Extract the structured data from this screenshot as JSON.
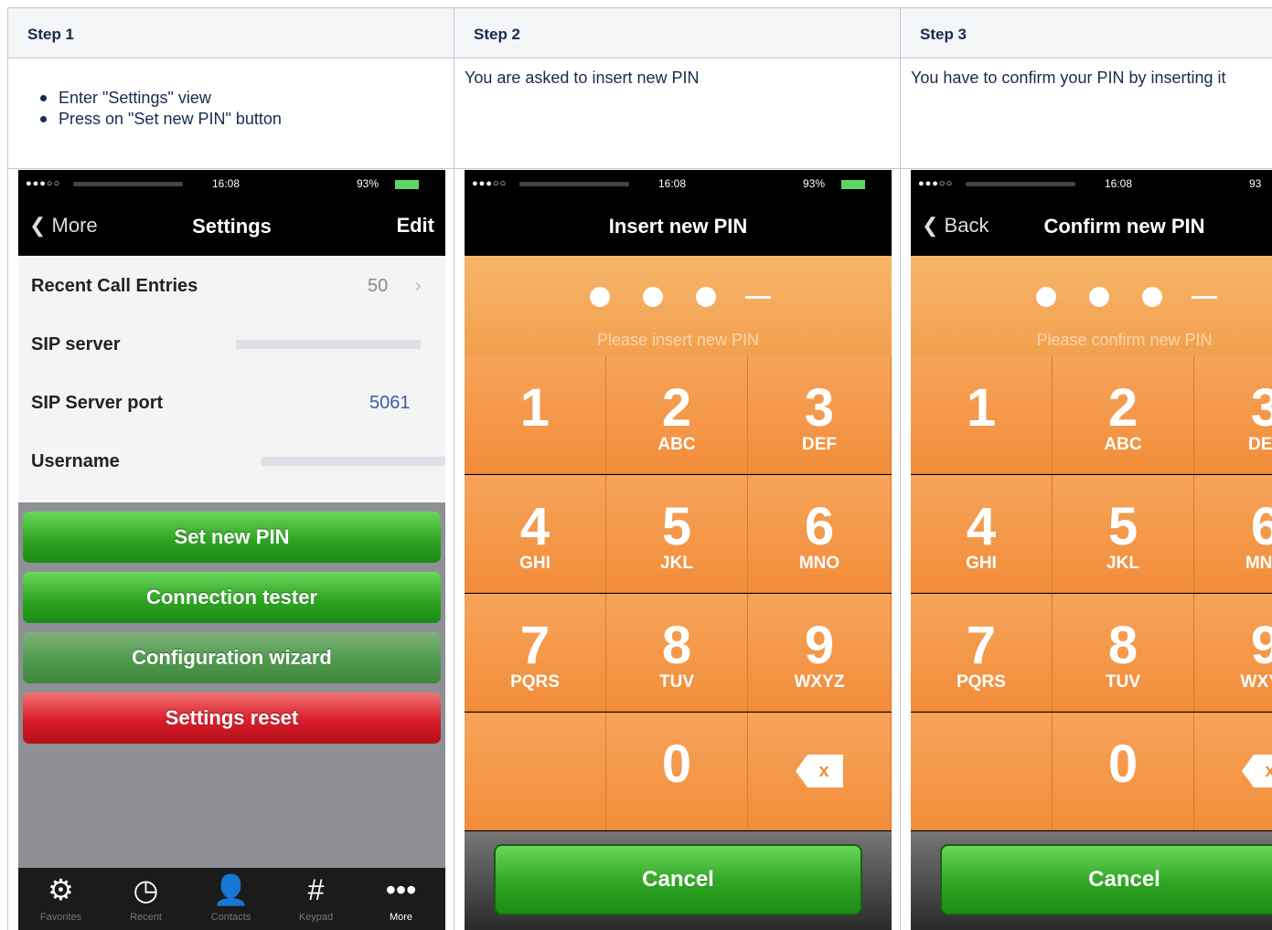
{
  "steps": [
    {
      "header": "Step 1",
      "bullets": [
        "Enter \"Settings\" view",
        "Press on \"Set new PIN\" button"
      ],
      "phone": {
        "status": {
          "time": "16:08",
          "battery": "93%"
        },
        "nav": {
          "back": "More",
          "title": "Settings",
          "action": "Edit"
        },
        "rows": [
          {
            "label": "Recent Call Entries",
            "value": "50"
          },
          {
            "label": "SIP server",
            "value": ""
          },
          {
            "label": "SIP Server port",
            "value": "5061"
          },
          {
            "label": "Username",
            "value": ""
          }
        ],
        "buttons": [
          "Set new PIN",
          "Connection tester",
          "Configuration wizard",
          "Settings reset"
        ],
        "tabs": [
          "Favorites",
          "Recent",
          "Contacts",
          "Keypad",
          "More"
        ]
      }
    },
    {
      "header": "Step 2",
      "description": "You are asked to insert new PIN",
      "phone": {
        "status": {
          "time": "16:08",
          "battery": "93%"
        },
        "nav": {
          "title": "Insert new PIN"
        },
        "hint": "Please insert new PIN",
        "cancel": "Cancel"
      }
    },
    {
      "header": "Step 3",
      "description": "You have to confirm your PIN by inserting it",
      "phone": {
        "status": {
          "time": "16:08",
          "battery": "93"
        },
        "nav": {
          "back": "Back",
          "title": "Confirm new PIN"
        },
        "hint": "Please confirm new PIN",
        "cancel": "Cancel"
      }
    }
  ],
  "keypad": [
    {
      "num": "1",
      "letters": ""
    },
    {
      "num": "2",
      "letters": "ABC"
    },
    {
      "num": "3",
      "letters": "DEF"
    },
    {
      "num": "4",
      "letters": "GHI"
    },
    {
      "num": "5",
      "letters": "JKL"
    },
    {
      "num": "6",
      "letters": "MNO"
    },
    {
      "num": "7",
      "letters": "PQRS"
    },
    {
      "num": "8",
      "letters": "TUV"
    },
    {
      "num": "9",
      "letters": "WXYZ"
    },
    {
      "num": "0",
      "letters": ""
    }
  ],
  "icons": {
    "back": "chevron-left-icon",
    "delete": "backspace-icon",
    "favorites": "gear-icon",
    "recent": "clock-icon",
    "contacts": "person-icon",
    "keypad": "hash-icon",
    "more": "ellipsis-icon"
  },
  "colors": {
    "accent_orange": "#f28d3a",
    "button_green": "#2fa523",
    "button_red": "#d91d2a",
    "status_battery": "#5fd463"
  }
}
